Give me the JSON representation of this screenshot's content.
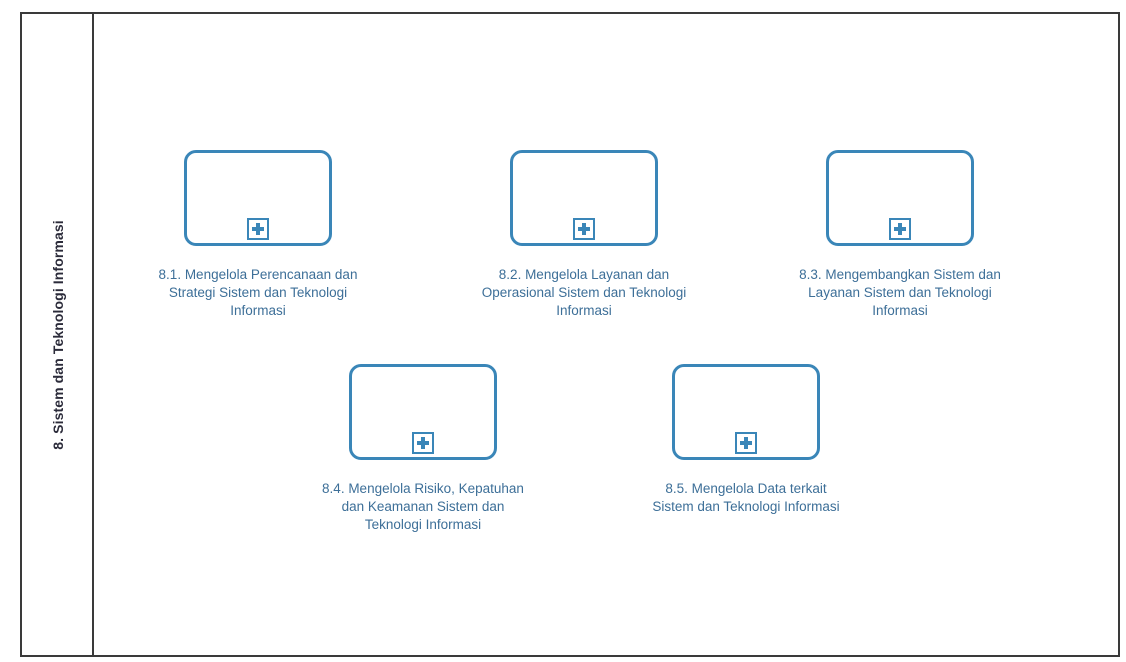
{
  "pool": {
    "lane_title": "8. Sistem dan Teknologi Informasi"
  },
  "tasks": [
    {
      "label": "8.1. Mengelola Perencanaan dan\nStrategi Sistem dan Teknologi\nInformasi"
    },
    {
      "label": "8.2. Mengelola Layanan dan\nOperasional Sistem dan Teknologi\nInformasi"
    },
    {
      "label": "8.3. Mengembangkan Sistem dan\nLayanan Sistem dan Teknologi\nInformasi"
    },
    {
      "label": "8.4. Mengelola Risiko, Kepatuhan\ndan Keamanan Sistem dan\nTeknologi Informasi"
    },
    {
      "label": "8.5. Mengelola Data terkait\nSistem dan Teknologi Informasi"
    }
  ],
  "colors": {
    "task_border": "#3a86b8",
    "label_text": "#3d6f98",
    "pool_border": "#3a3a3a"
  },
  "icons": {
    "subprocess_marker": "plus-square-icon"
  }
}
